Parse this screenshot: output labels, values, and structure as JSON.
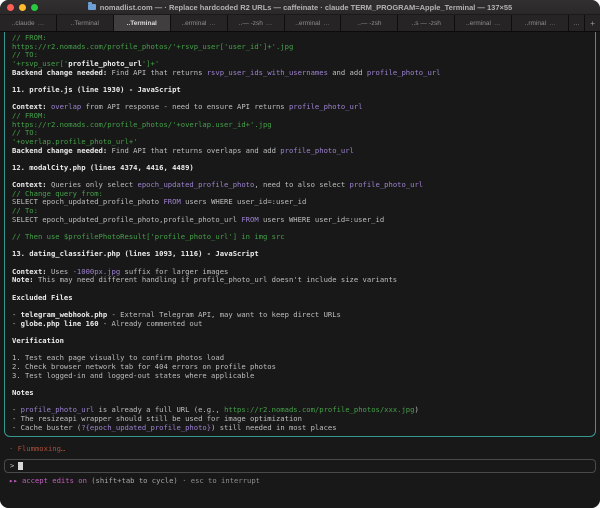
{
  "window": {
    "title": "nomadlist.com — · Replace hardcoded R2 URLs — caffeinate · claude TERM_PROGRAM=Apple_Terminal — 137×55"
  },
  "colors": {
    "background": "#181818",
    "box_border_teal": "#37988f",
    "comment_green": "#45a049",
    "token_purple": "#9c82cf",
    "status_magenta": "#c45fc0",
    "spinner_red": "#aa4f3d",
    "bold_white": "#ececec",
    "traffic_red": "#ff5f57",
    "traffic_yellow": "#febc2e",
    "traffic_green": "#28c840"
  },
  "tabbar": {
    "tabs": [
      {
        "label": "..claude",
        "badge": "…",
        "active": false
      },
      {
        "label": "..Terminal",
        "badge": "",
        "active": false
      },
      {
        "label": "..Terminal",
        "badge": "",
        "active": true
      },
      {
        "label": "..erminal",
        "badge": "…",
        "active": false
      },
      {
        "label": "..— -zsh",
        "badge": "…",
        "active": false
      },
      {
        "label": "..erminal",
        "badge": "…",
        "active": false
      },
      {
        "label": "..— -zsh",
        "badge": "",
        "active": false
      },
      {
        "label": "..s — -zsh",
        "badge": "",
        "active": false
      },
      {
        "label": "..erminal",
        "badge": "…",
        "active": false
      },
      {
        "label": "..rminal",
        "badge": "…",
        "active": false
      }
    ],
    "overflow_indicator": "…",
    "new_tab_label": "+"
  },
  "terminal": {
    "lines": [
      [
        {
          "t": "// FROM:",
          "s": "g"
        }
      ],
      [
        {
          "t": "https://r2.nomads.com/profile_photos/'+rsvp_user['user_id']+'.jpg",
          "s": "g"
        }
      ],
      [
        {
          "t": "// TO:",
          "s": "g"
        }
      ],
      [
        {
          "t": "'+rsvp_user['",
          "s": "g"
        },
        {
          "t": "profile_photo_url",
          "s": "b"
        },
        {
          "t": "']+'",
          "s": "g"
        }
      ],
      [
        {
          "t": "Backend change needed:",
          "s": "b"
        },
        {
          "t": " Find API that returns "
        },
        {
          "t": "rsvp_user_ids_with_usernames",
          "s": "p"
        },
        {
          "t": " and add "
        },
        {
          "t": "profile_photo_url",
          "s": "p"
        }
      ],
      [],
      [
        {
          "t": "11. profile.js (line 1930) - JavaScript",
          "s": "b"
        }
      ],
      [],
      [
        {
          "t": "Context:",
          "s": "b"
        },
        {
          "t": " "
        },
        {
          "t": "overlap",
          "s": "p"
        },
        {
          "t": " from API response - need to ensure API returns "
        },
        {
          "t": "profile_photo_url",
          "s": "p"
        }
      ],
      [
        {
          "t": "// FROM:",
          "s": "g"
        }
      ],
      [
        {
          "t": "https://r2.nomads.com/profile_photos/'+overlap.user_id+'.jpg",
          "s": "g"
        }
      ],
      [
        {
          "t": "// TO:",
          "s": "g"
        }
      ],
      [
        {
          "t": "'+overlap.profile_photo_url+'",
          "s": "g"
        }
      ],
      [
        {
          "t": "Backend change needed:",
          "s": "b"
        },
        {
          "t": " Find API that returns overlaps and add "
        },
        {
          "t": "profile_photo_url",
          "s": "p"
        }
      ],
      [],
      [
        {
          "t": "12. modalCity.php (lines 4374, 4416, 4489)",
          "s": "b"
        }
      ],
      [],
      [
        {
          "t": "Context:",
          "s": "b"
        },
        {
          "t": " Queries only select "
        },
        {
          "t": "epoch_updated_profile_photo",
          "s": "p"
        },
        {
          "t": ", need to also select "
        },
        {
          "t": "profile_photo_url",
          "s": "p"
        }
      ],
      [
        {
          "t": "// Change query from:",
          "s": "g"
        }
      ],
      [
        {
          "t": "SELECT epoch_updated_profile_photo "
        },
        {
          "t": "FROM",
          "s": "p"
        },
        {
          "t": " users WHERE user_id=:user_id"
        }
      ],
      [
        {
          "t": "// To:",
          "s": "g"
        }
      ],
      [
        {
          "t": "SELECT epoch_updated_profile_photo,profile_photo_url "
        },
        {
          "t": "FROM",
          "s": "p"
        },
        {
          "t": " users WHERE user_id=:user_id"
        }
      ],
      [],
      [
        {
          "t": "// Then use $profilePhotoResult['profile_photo_url'] in img src",
          "s": "g"
        }
      ],
      [],
      [
        {
          "t": "13. dating_classifier.php (lines 1093, 1116) - JavaScript",
          "s": "b"
        }
      ],
      [],
      [
        {
          "t": "Context:",
          "s": "b"
        },
        {
          "t": " Uses "
        },
        {
          "t": "-1000px.jpg",
          "s": "p"
        },
        {
          "t": " suffix for larger images"
        }
      ],
      [
        {
          "t": "Note:",
          "s": "b"
        },
        {
          "t": " This may need different handling if profile_photo_url doesn't include size variants"
        }
      ],
      [],
      [
        {
          "t": "Excluded Files",
          "s": "b"
        }
      ],
      [],
      [
        {
          "t": "- "
        },
        {
          "t": "telegram_webhook.php",
          "s": "b"
        },
        {
          "t": " - External Telegram API, may want to keep direct URLs"
        }
      ],
      [
        {
          "t": "- "
        },
        {
          "t": "globe.php line 160",
          "s": "b"
        },
        {
          "t": " - Already commented out"
        }
      ],
      [],
      [
        {
          "t": "Verification",
          "s": "b"
        }
      ],
      [],
      [
        {
          "t": "1. Test each page visually to confirm photos load"
        }
      ],
      [
        {
          "t": "2. Check browser network tab for 404 errors on profile photos"
        }
      ],
      [
        {
          "t": "3. Test logged-in and logged-out states where applicable"
        }
      ],
      [],
      [
        {
          "t": "Notes",
          "s": "b"
        }
      ],
      [],
      [
        {
          "t": "- "
        },
        {
          "t": "profile_photo_url",
          "s": "p"
        },
        {
          "t": " is already a full URL (e.g., "
        },
        {
          "t": "https://r2.nomads.com/profile_photos/xxx.jpg",
          "s": "g"
        },
        {
          "t": ")"
        }
      ],
      [
        {
          "t": "- The resizeapi wrapper should still be used for image optimization"
        }
      ],
      [
        {
          "t": "- Cache buster ("
        },
        {
          "t": "?{epoch_updated_profile_photo}",
          "s": "p"
        },
        {
          "t": ") still needed in most places"
        }
      ]
    ],
    "spinner_text": "· Flummoxing…",
    "prompt": ">",
    "status": [
      {
        "t": "▸▸ accept edits on",
        "s": "m"
      },
      {
        "t": " (shift+tab to cycle)",
        "s": "d1"
      },
      {
        "t": " · esc to interrupt",
        "s": "d2"
      }
    ]
  }
}
